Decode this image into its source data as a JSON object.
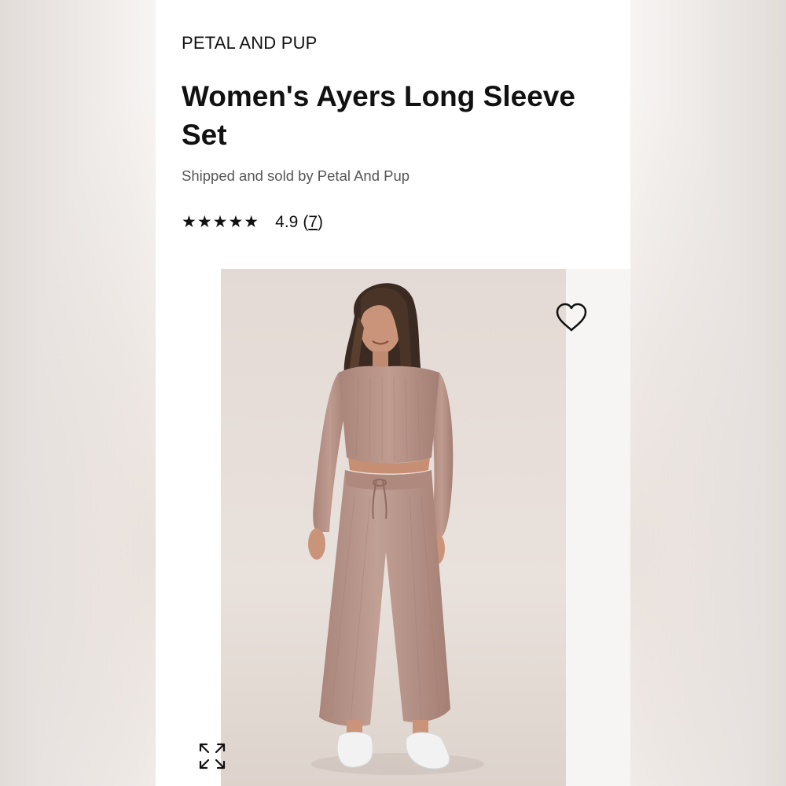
{
  "product": {
    "brand": "PETAL AND PUP",
    "title": "Women's Ayers Long Sleeve Set",
    "seller": "Shipped and sold by Petal And Pup",
    "rating": {
      "stars_display": "★★★★★",
      "score": 4.9,
      "score_text": "4.9",
      "count": 7,
      "count_open": "(",
      "count_text": "7",
      "count_close": ")"
    },
    "image": {
      "alt_subject": "Model wearing matching taupe knit crop top and wide-leg pants",
      "colors": {
        "background": "#e6ddd8",
        "garment": "#b48f86",
        "skin": "#c99479",
        "hair": "#3a2a22",
        "shoes": "#f2f2f2"
      }
    },
    "icons": {
      "favorite": "heart-outline-icon",
      "expand": "expand-arrows-icon"
    }
  }
}
